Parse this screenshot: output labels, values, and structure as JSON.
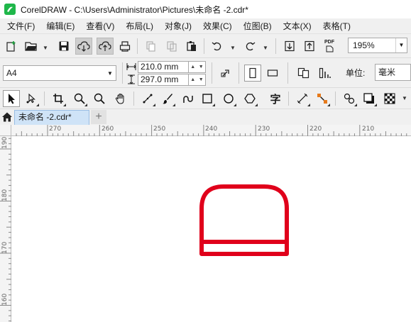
{
  "window": {
    "title": "CorelDRAW - C:\\Users\\Administrator\\Pictures\\未命名 -2.cdr*"
  },
  "menubar": {
    "items": [
      {
        "label": "文件(F)"
      },
      {
        "label": "编辑(E)"
      },
      {
        "label": "查看(V)"
      },
      {
        "label": "布局(L)"
      },
      {
        "label": "对象(J)"
      },
      {
        "label": "效果(C)"
      },
      {
        "label": "位图(B)"
      },
      {
        "label": "文本(X)"
      },
      {
        "label": "表格(T)"
      }
    ]
  },
  "toolbar": {
    "zoom": "195%",
    "pdf_label": "PDF"
  },
  "property_bar": {
    "page_size": "A4",
    "width": "210.0 mm",
    "height": "297.0 mm",
    "unit_label": "单位:",
    "unit_value": "毫米"
  },
  "toolbox": {
    "text_tool_glyph": "字"
  },
  "doc_tabs": {
    "active_tab": "未命名 -2.cdr*",
    "add_tab": "+"
  },
  "rulers": {
    "horizontal": [
      "270",
      "260",
      "250",
      "240",
      "230",
      "220",
      "210"
    ],
    "vertical": [
      "190",
      "180",
      "170",
      "160"
    ]
  },
  "colors": {
    "shape_stroke": "#e0001b",
    "app_accent": "#1fb74a",
    "active_tab_bg": "#cfe3f7"
  }
}
